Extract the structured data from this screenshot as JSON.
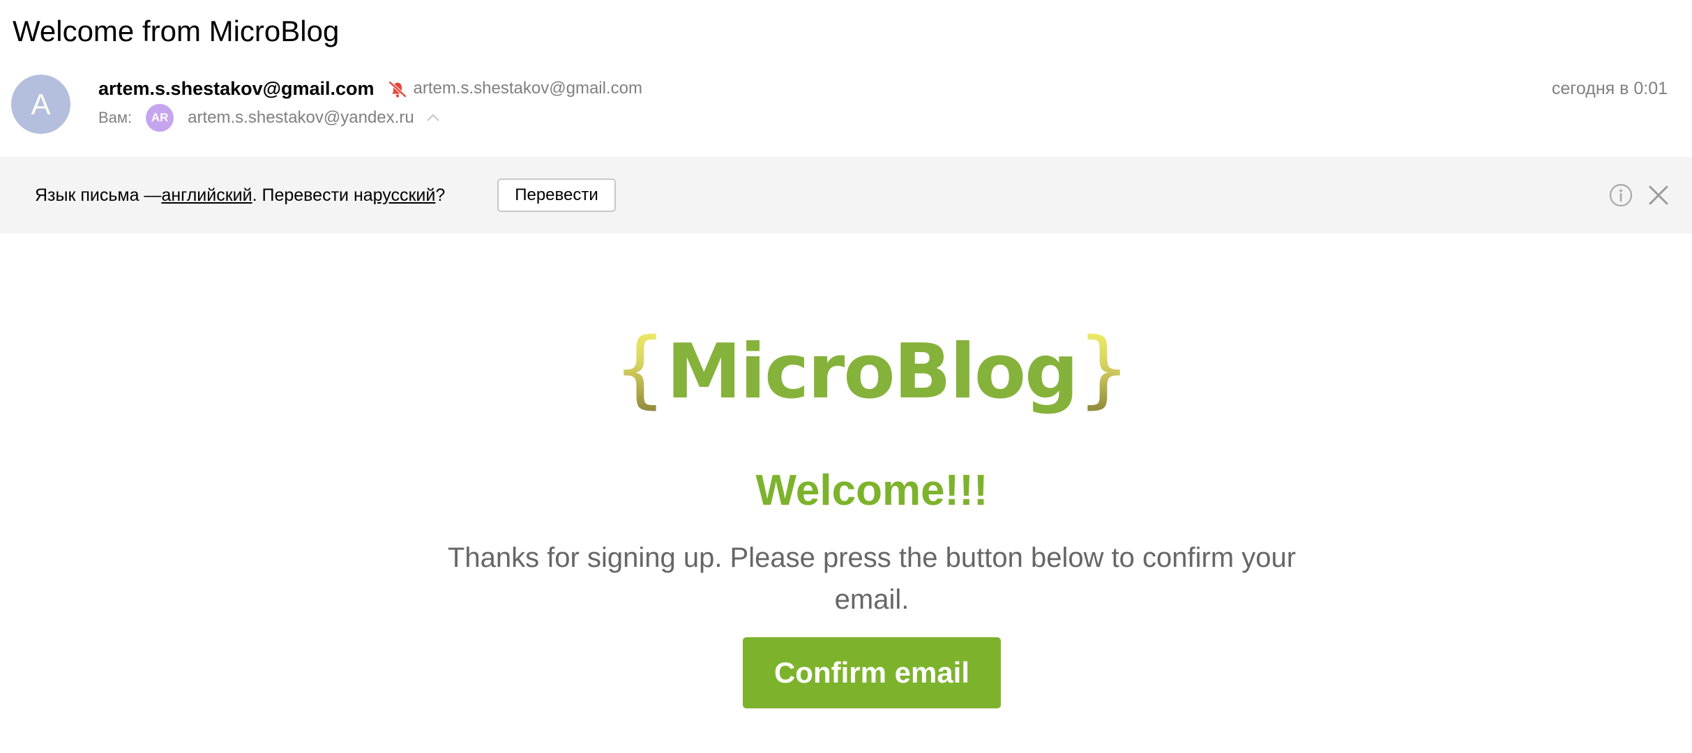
{
  "email": {
    "subject": "Welcome from MicroBlog",
    "sender": {
      "avatar_letter": "A",
      "name": "artem.s.shestakov@gmail.com",
      "address": "artem.s.shestakov@gmail.com",
      "icon": "noreply-warning-icon"
    },
    "recipient": {
      "label": "Вам:",
      "avatar_initials": "AR",
      "address": "artem.s.shestakov@yandex.ru"
    },
    "date": "сегодня в 0:01"
  },
  "translate_bar": {
    "prefix": "Язык письма — ",
    "source_language": "английский",
    "middle": ". Перевести на ",
    "target_language": "русский",
    "suffix": "?",
    "button_label": "Перевести"
  },
  "body": {
    "logo": {
      "brace_open": "{",
      "word": "MicroBlog",
      "brace_close": "}"
    },
    "headline": "Welcome!!!",
    "message": "Thanks for signing up. Please press the button below to confirm your email.",
    "button_label": "Confirm email"
  },
  "colors": {
    "brand_green": "#7db32c",
    "logo_green": "#85b23a",
    "avatar_sender": "#b4bedd",
    "avatar_recipient": "#c6a5ef",
    "warning_red": "#e8453c",
    "muted_text": "#808080",
    "bar_bg": "#f4f4f4"
  }
}
